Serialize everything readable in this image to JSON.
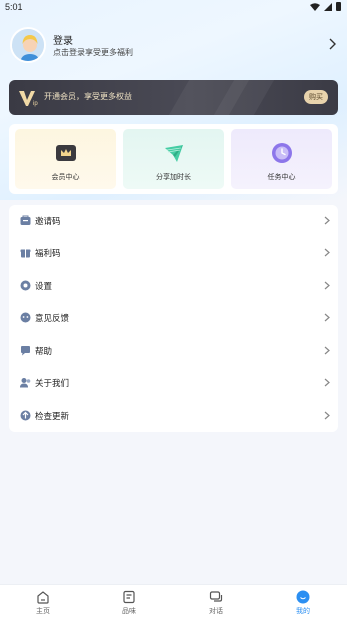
{
  "status_bar": {
    "time": "5:01"
  },
  "profile": {
    "title": "登录",
    "subtitle": "点击登录享受更多福利"
  },
  "vip_banner": {
    "text": "开通会员，享受更多权益",
    "button_label": "购买"
  },
  "shortcuts": [
    {
      "label": "会员中心",
      "icon": "crown-icon"
    },
    {
      "label": "分享加时长",
      "icon": "share-icon"
    },
    {
      "label": "任务中心",
      "icon": "task-clock-icon"
    }
  ],
  "menu": [
    {
      "label": "邀请码",
      "icon": "invite-code-icon"
    },
    {
      "label": "福利码",
      "icon": "gift-icon"
    },
    {
      "label": "设置",
      "icon": "settings-icon"
    },
    {
      "label": "意见反馈",
      "icon": "feedback-icon"
    },
    {
      "label": "帮助",
      "icon": "help-icon"
    },
    {
      "label": "关于我们",
      "icon": "about-us-icon"
    },
    {
      "label": "检查更新",
      "icon": "update-icon"
    }
  ],
  "tabs": [
    {
      "label": "主页",
      "icon": "home-icon",
      "active": false
    },
    {
      "label": "品味",
      "icon": "document-icon",
      "active": false
    },
    {
      "label": "对话",
      "icon": "chat-icon",
      "active": false
    },
    {
      "label": "我的",
      "icon": "profile-icon",
      "active": true
    }
  ],
  "colors": {
    "accent": "#2b8ff2",
    "vip_gold": "#e8d3ac",
    "vip_dark": "#3a3a44"
  }
}
